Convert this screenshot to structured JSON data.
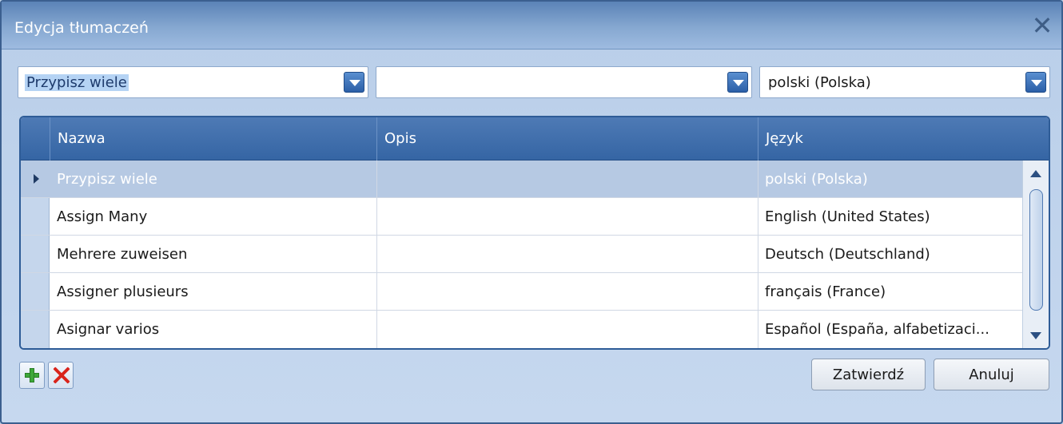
{
  "window": {
    "title": "Edycja tłumaczeń",
    "close_symbol": "✕"
  },
  "filters": {
    "name_combo": "Przypisz wiele",
    "desc_combo": "",
    "lang_combo": "polski (Polska)"
  },
  "grid": {
    "columns": [
      "Nazwa",
      "Opis",
      "Język"
    ],
    "rows": [
      {
        "name": "Przypisz wiele",
        "desc": "",
        "lang": "polski (Polska)",
        "selected": true
      },
      {
        "name": "Assign Many",
        "desc": "",
        "lang": "English (United States)",
        "selected": false
      },
      {
        "name": "Mehrere zuweisen",
        "desc": "",
        "lang": "Deutsch (Deutschland)",
        "selected": false
      },
      {
        "name": "Assigner plusieurs",
        "desc": "",
        "lang": "français (France)",
        "selected": false
      },
      {
        "name": "Asignar varios",
        "desc": "",
        "lang": "Español (España, alfabetizaci...",
        "selected": false
      }
    ]
  },
  "icons": {
    "add": "plus-icon",
    "delete": "delete-x-icon",
    "add_color": "#3ea83a",
    "delete_color": "#d9241c"
  },
  "buttons": {
    "confirm": "Zatwierdź",
    "cancel": "Anuluj"
  }
}
